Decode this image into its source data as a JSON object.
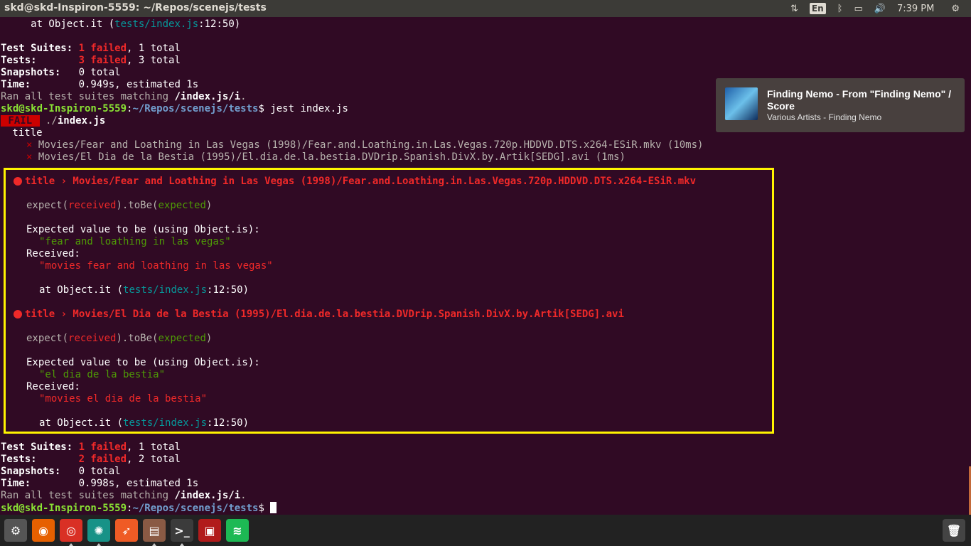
{
  "window": {
    "title": "skd@skd-Inspiron-5559: ~/Repos/scenejs/tests"
  },
  "tray": {
    "network_icon": "updown-arrows-icon",
    "keyboard_lang": "En",
    "bluetooth_icon": "bluetooth-icon",
    "battery_icon": "battery-icon",
    "volume_icon": "volume-icon",
    "time": "7:39 PM",
    "settings_icon": "power-gear-icon"
  },
  "notification": {
    "title": "Finding Nemo - From \"Finding Nemo\" / Score",
    "subtitle": "Various Artists - Finding Nemo"
  },
  "terminal": {
    "l0_pre": "     at Object.it (",
    "l0_path": "tests/index.js",
    "l0_post": ":12:50)",
    "s1": {
      "suites_label": "Test Suites: ",
      "suites_failed": "1 failed",
      "suites_rest": ", 1 total",
      "tests_label": "Tests:       ",
      "tests_failed": "3 failed",
      "tests_rest": ", 3 total",
      "snap_label": "Snapshots:   ",
      "snap_rest": "0 total",
      "time_label": "Time:        ",
      "time_rest": "0.949s, estimated 1s",
      "ran": "Ran all test suites matching ",
      "ran_pattern": "/index.js/i",
      "ran_end": "."
    },
    "prompt_user": "skd@skd-Inspiron-5559",
    "prompt_colon": ":",
    "prompt_path": "~/Repos/scenejs/tests",
    "prompt_end": "$ ",
    "command": "jest index.js",
    "fail_badge": " FAIL ",
    "fail_file_pre": " ./",
    "fail_file": "index.js",
    "describe": " title",
    "x": "×",
    "test1": " Movies/Fear and Loathing in Las Vegas (1998)/Fear.and.Loathing.in.Las.Vegas.720p.HDDVD.DTS.x264-ESiR.mkv (10ms)",
    "test2": " Movies/El Dia de la Bestia (1995)/El.dia.de.la.bestia.DVDrip.Spanish.DivX.by.Artik[SEDG].avi (1ms)",
    "err1_title": "title › Movies/Fear and Loathing in Las Vegas (1998)/Fear.and.Loathing.in.Las.Vegas.720p.HDDVD.DTS.x264-ESiR.mkv",
    "err2_title": "title › Movies/El Dia de la Bestia (1995)/El.dia.de.la.bestia.DVDrip.Spanish.DivX.by.Artik[SEDG].avi",
    "expect_a": "expect(",
    "received_word": "received",
    "expect_b": ").toBe(",
    "expected_word": "expected",
    "expect_c": ")",
    "expected_value_line": "Expected value to be (using Object.is):",
    "err1_expected": "\"fear and loathing in las vegas\"",
    "received_label": "Received:",
    "err1_received": "\"movies fear and loathing in las vegas\"",
    "at_pre": "at Object.it (",
    "at_path": "tests/index.js",
    "at_post": ":12:50)",
    "err2_expected": "\"el dia de la bestia\"",
    "err2_received": "\"movies el dia de la bestia\"",
    "s2": {
      "suites_failed": "1 failed",
      "suites_rest": ", 1 total",
      "tests_failed": "2 failed",
      "tests_rest": ", 2 total",
      "snap_rest": "0 total",
      "time_rest": "0.998s, estimated 1s"
    }
  },
  "dock": [
    {
      "name": "ubuntu-settings-icon",
      "glyph": "⚙",
      "bg": "#555555"
    },
    {
      "name": "firefox-icon",
      "glyph": "◉",
      "bg": "#e66000"
    },
    {
      "name": "chrome-icon",
      "glyph": "◎",
      "bg": "#d93025"
    },
    {
      "name": "gitkraken-icon",
      "glyph": "✺",
      "bg": "#179287"
    },
    {
      "name": "postman-icon",
      "glyph": "➶",
      "bg": "#ef5b25"
    },
    {
      "name": "files-icon",
      "glyph": "▤",
      "bg": "#8a5a44"
    },
    {
      "name": "terminal-icon",
      "glyph": ">_",
      "bg": "#3b3b3b"
    },
    {
      "name": "screen-recorder-icon",
      "glyph": "▣",
      "bg": "#b11b1b"
    },
    {
      "name": "spotify-icon",
      "glyph": "≋",
      "bg": "#1db954"
    }
  ],
  "trash": {
    "glyph": "🗑"
  }
}
